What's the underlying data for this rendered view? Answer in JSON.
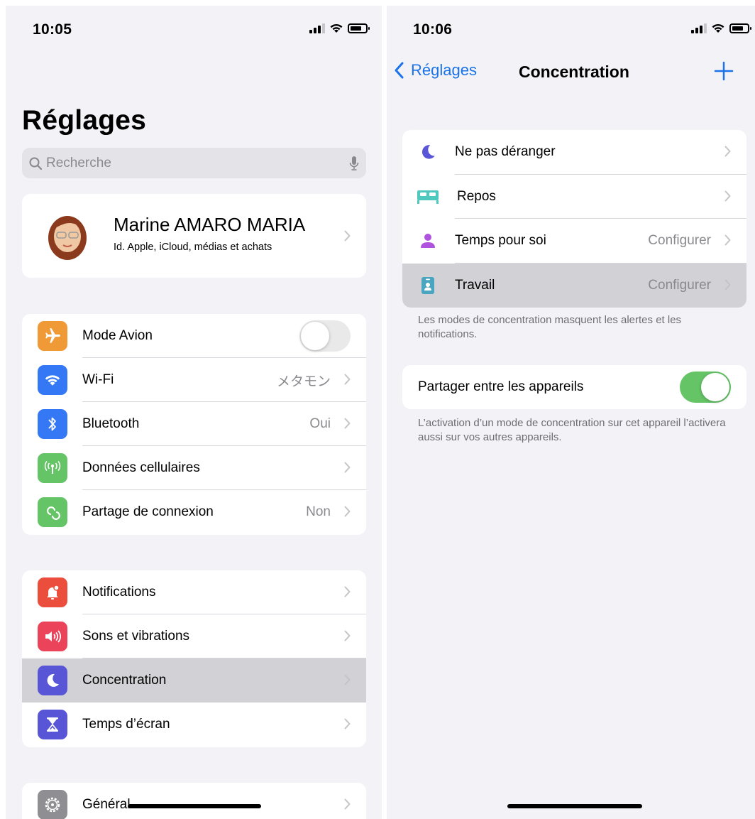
{
  "left": {
    "status": {
      "time": "10:05"
    },
    "title": "Réglages",
    "search": {
      "placeholder": "Recherche"
    },
    "profile": {
      "name": "Marine AMARO MARIA",
      "subtitle": "Id. Apple, iCloud, médias et achats"
    },
    "group1": [
      {
        "label": "Mode Avion",
        "value": "",
        "color": "#f09a37",
        "icon": "airplane-icon",
        "toggle": false
      },
      {
        "label": "Wi-Fi",
        "value": "メタモン",
        "color": "#3478f6",
        "icon": "wifi-icon"
      },
      {
        "label": "Bluetooth",
        "value": "Oui",
        "color": "#3478f6",
        "icon": "bluetooth-icon"
      },
      {
        "label": "Données cellulaires",
        "value": "",
        "color": "#65c466",
        "icon": "antenna-icon"
      },
      {
        "label": "Partage de connexion",
        "value": "Non",
        "color": "#65c466",
        "icon": "link-icon"
      }
    ],
    "group2": [
      {
        "label": "Notifications",
        "value": "",
        "color": "#eb4e3d",
        "icon": "bell-icon"
      },
      {
        "label": "Sons et vibrations",
        "value": "",
        "color": "#eb445a",
        "icon": "speaker-icon"
      },
      {
        "label": "Concentration",
        "value": "",
        "color": "#5856d6",
        "icon": "moon-icon",
        "selected": true
      },
      {
        "label": "Temps d’écran",
        "value": "",
        "color": "#5856d6",
        "icon": "hourglass-icon"
      }
    ],
    "group3": [
      {
        "label": "Général",
        "value": "",
        "color": "#8e8e93",
        "icon": "gear-icon"
      }
    ]
  },
  "right": {
    "status": {
      "time": "10:06"
    },
    "nav": {
      "back_label": "Réglages",
      "title": "Concentration"
    },
    "focus_modes": [
      {
        "label": "Ne pas déranger",
        "value": "",
        "color": "#5856d6",
        "icon": "moon-icon"
      },
      {
        "label": "Repos",
        "value": "",
        "color": "#4fc9c0",
        "icon": "bed-icon"
      },
      {
        "label": "Temps pour soi",
        "value": "Configurer",
        "color": "#af52de",
        "icon": "person-icon"
      },
      {
        "label": "Travail",
        "value": "Configurer",
        "color": "#4aa6c0",
        "icon": "id-badge-icon",
        "selected": true
      }
    ],
    "focus_note": "Les modes de concentration masquent les alertes et les notifications.",
    "share": {
      "label": "Partager entre les appareils",
      "on": true,
      "toggle_color": "#65c466"
    },
    "share_note": "L’activation d’un mode de concentration sur cet appareil l’activera aussi sur vos autres appareils."
  }
}
